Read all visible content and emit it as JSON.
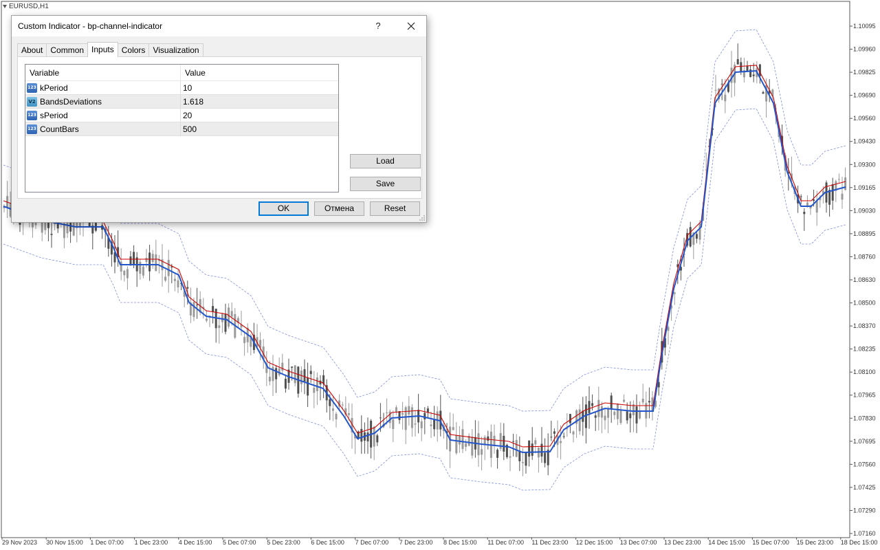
{
  "chart": {
    "symbol": "EURUSD,H1",
    "price_labels": [
      "1.10095",
      "1.09960",
      "1.09825",
      "1.09690",
      "1.09560",
      "1.09430",
      "1.09300",
      "1.09165",
      "1.09030",
      "1.08895",
      "1.08760",
      "1.08630",
      "1.08500",
      "1.08370",
      "1.08235",
      "1.08100",
      "1.07965",
      "1.07830",
      "1.07695",
      "1.07560",
      "1.07425",
      "1.07290",
      "1.07160"
    ],
    "time_labels": [
      "29 Nov 2023",
      "30 Nov 15:00",
      "1 Dec 07:00",
      "1 Dec 23:00",
      "4 Dec 15:00",
      "5 Dec 07:00",
      "5 Dec 23:00",
      "6 Dec 15:00",
      "7 Dec 07:00",
      "7 Dec 23:00",
      "8 Dec 15:00",
      "11 Dec 07:00",
      "11 Dec 23:00",
      "12 Dec 15:00",
      "13 Dec 07:00",
      "13 Dec 23:00",
      "14 Dec 15:00",
      "15 Dec 07:00",
      "15 Dec 23:00",
      "18 Dec 15:00"
    ],
    "colors": {
      "candle": "#9a9a9a",
      "candle_dark": "#505050",
      "signal_line": "#2255cc",
      "upper_line": "#cc0000",
      "bands": "#7f8fd8",
      "axis": "#555555"
    }
  },
  "dialog": {
    "title": "Custom Indicator - bp-channel-indicator",
    "help": "?",
    "tabs": [
      "About",
      "Common",
      "Inputs",
      "Colors",
      "Visualization"
    ],
    "active_tab": "Inputs",
    "grid_headers": {
      "variable": "Variable",
      "value": "Value"
    },
    "parameters": [
      {
        "type_icon": "123",
        "name": "kPeriod",
        "value": "10"
      },
      {
        "type_icon": "V2",
        "name": "BandsDeviations",
        "value": "1.618"
      },
      {
        "type_icon": "123",
        "name": "sPeriod",
        "value": "20"
      },
      {
        "type_icon": "123",
        "name": "CountBars",
        "value": "500"
      }
    ],
    "load_label": "Load",
    "save_label": "Save",
    "ok_label": "OK",
    "cancel_label": "Отмена",
    "reset_label": "Reset"
  }
}
